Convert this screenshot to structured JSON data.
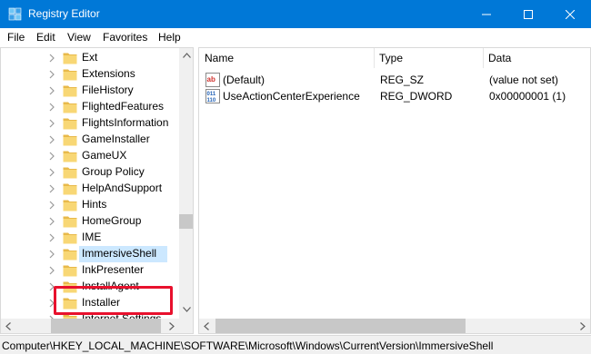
{
  "window": {
    "title": "Registry Editor"
  },
  "menu": [
    {
      "label": "File"
    },
    {
      "label": "Edit"
    },
    {
      "label": "View"
    },
    {
      "label": "Favorites"
    },
    {
      "label": "Help"
    }
  ],
  "tree": {
    "items": [
      {
        "label": "Ext"
      },
      {
        "label": "Extensions"
      },
      {
        "label": "FileHistory"
      },
      {
        "label": "FlightedFeatures"
      },
      {
        "label": "FlightsInformation"
      },
      {
        "label": "GameInstaller"
      },
      {
        "label": "GameUX"
      },
      {
        "label": "Group Policy"
      },
      {
        "label": "HelpAndSupport"
      },
      {
        "label": "Hints"
      },
      {
        "label": "HomeGroup"
      },
      {
        "label": "IME"
      },
      {
        "label": "ImmersiveShell",
        "selected": true
      },
      {
        "label": "InkPresenter"
      },
      {
        "label": "InstallAgent"
      },
      {
        "label": "Installer"
      },
      {
        "label": "Internet Settings"
      }
    ]
  },
  "values": {
    "columns": {
      "name": "Name",
      "type": "Type",
      "data": "Data"
    },
    "rows": [
      {
        "name": "(Default)",
        "type": "REG_SZ",
        "data": "(value not set)",
        "icon": "string-value-icon"
      },
      {
        "name": "UseActionCenterExperience",
        "type": "REG_DWORD",
        "data": "0x00000001 (1)",
        "icon": "binary-value-icon"
      }
    ]
  },
  "status": {
    "path": "Computer\\HKEY_LOCAL_MACHINE\\SOFTWARE\\Microsoft\\Windows\\CurrentVersion\\ImmersiveShell"
  },
  "colors": {
    "titlebar": "#0078d7",
    "selection": "#cce8ff",
    "highlight": "#e8112d",
    "folder": "#f8d775"
  }
}
